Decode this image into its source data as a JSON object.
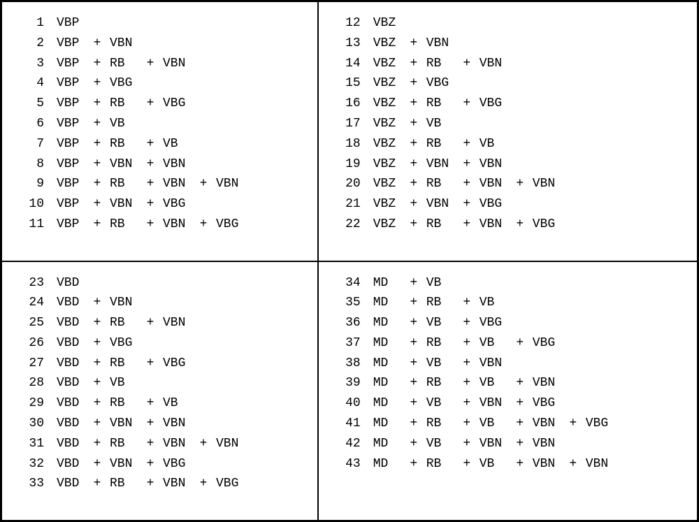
{
  "plus": "+",
  "quads": [
    {
      "rows": [
        {
          "n": "1",
          "tags": [
            "VBP"
          ]
        },
        {
          "n": "2",
          "tags": [
            "VBP",
            "VBN"
          ]
        },
        {
          "n": "3",
          "tags": [
            "VBP",
            "RB",
            "VBN"
          ]
        },
        {
          "n": "4",
          "tags": [
            "VBP",
            "VBG"
          ]
        },
        {
          "n": "5",
          "tags": [
            "VBP",
            "RB",
            "VBG"
          ]
        },
        {
          "n": "6",
          "tags": [
            "VBP",
            "VB"
          ]
        },
        {
          "n": "7",
          "tags": [
            "VBP",
            "RB",
            "VB"
          ]
        },
        {
          "n": "8",
          "tags": [
            "VBP",
            "VBN",
            "VBN"
          ]
        },
        {
          "n": "9",
          "tags": [
            "VBP",
            "RB",
            "VBN",
            "VBN"
          ]
        },
        {
          "n": "10",
          "tags": [
            "VBP",
            "VBN",
            "VBG"
          ]
        },
        {
          "n": "11",
          "tags": [
            "VBP",
            "RB",
            "VBN",
            "VBG"
          ]
        }
      ]
    },
    {
      "rows": [
        {
          "n": "12",
          "tags": [
            "VBZ"
          ]
        },
        {
          "n": "13",
          "tags": [
            "VBZ",
            "VBN"
          ]
        },
        {
          "n": "14",
          "tags": [
            "VBZ",
            "RB",
            "VBN"
          ]
        },
        {
          "n": "15",
          "tags": [
            "VBZ",
            "VBG"
          ]
        },
        {
          "n": "16",
          "tags": [
            "VBZ",
            "RB",
            "VBG"
          ]
        },
        {
          "n": "17",
          "tags": [
            "VBZ",
            "VB"
          ]
        },
        {
          "n": "18",
          "tags": [
            "VBZ",
            "RB",
            "VB"
          ]
        },
        {
          "n": "19",
          "tags": [
            "VBZ",
            "VBN",
            "VBN"
          ]
        },
        {
          "n": "20",
          "tags": [
            "VBZ",
            "RB",
            "VBN",
            "VBN"
          ]
        },
        {
          "n": "21",
          "tags": [
            "VBZ",
            "VBN",
            "VBG"
          ]
        },
        {
          "n": "22",
          "tags": [
            "VBZ",
            "RB",
            "VBN",
            "VBG"
          ]
        }
      ]
    },
    {
      "rows": [
        {
          "n": "23",
          "tags": [
            "VBD"
          ]
        },
        {
          "n": "24",
          "tags": [
            "VBD",
            "VBN"
          ]
        },
        {
          "n": "25",
          "tags": [
            "VBD",
            "RB",
            "VBN"
          ]
        },
        {
          "n": "26",
          "tags": [
            "VBD",
            "VBG"
          ]
        },
        {
          "n": "27",
          "tags": [
            "VBD",
            "RB",
            "VBG"
          ]
        },
        {
          "n": "28",
          "tags": [
            "VBD",
            "VB"
          ]
        },
        {
          "n": "29",
          "tags": [
            "VBD",
            "RB",
            "VB"
          ]
        },
        {
          "n": "30",
          "tags": [
            "VBD",
            "VBN",
            "VBN"
          ]
        },
        {
          "n": "31",
          "tags": [
            "VBD",
            "RB",
            "VBN",
            "VBN"
          ]
        },
        {
          "n": "32",
          "tags": [
            "VBD",
            "VBN",
            "VBG"
          ]
        },
        {
          "n": "33",
          "tags": [
            "VBD",
            "RB",
            "VBN",
            "VBG"
          ]
        }
      ]
    },
    {
      "rows": [
        {
          "n": "34",
          "tags": [
            "MD",
            "VB"
          ]
        },
        {
          "n": "35",
          "tags": [
            "MD",
            "RB",
            "VB"
          ]
        },
        {
          "n": "36",
          "tags": [
            "MD",
            "VB",
            "VBG"
          ]
        },
        {
          "n": "37",
          "tags": [
            "MD",
            "RB",
            "VB",
            "VBG"
          ]
        },
        {
          "n": "38",
          "tags": [
            "MD",
            "VB",
            "VBN"
          ]
        },
        {
          "n": "39",
          "tags": [
            "MD",
            "RB",
            "VB",
            "VBN"
          ]
        },
        {
          "n": "40",
          "tags": [
            "MD",
            "VB",
            "VBN",
            "VBG"
          ]
        },
        {
          "n": "41",
          "tags": [
            "MD",
            "RB",
            "VB",
            "VBN",
            "VBG"
          ]
        },
        {
          "n": "42",
          "tags": [
            "MD",
            "VB",
            "VBN",
            "VBN"
          ]
        },
        {
          "n": "43",
          "tags": [
            "MD",
            "RB",
            "VB",
            "VBN",
            "VBN"
          ]
        }
      ]
    }
  ]
}
